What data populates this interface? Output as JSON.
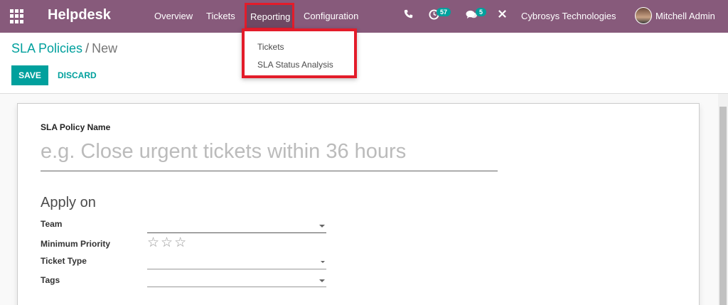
{
  "navbar": {
    "brand": "Helpdesk",
    "menu": {
      "overview": "Overview",
      "tickets": "Tickets",
      "reporting": "Reporting",
      "configuration": "Configuration"
    },
    "activity_badge": "57",
    "messages_badge": "5",
    "company": "Cybrosys Technologies",
    "user": "Mitchell Admin"
  },
  "dropdown": {
    "items": [
      "Tickets",
      "SLA Status Analysis"
    ]
  },
  "breadcrumb": {
    "parent": "SLA Policies",
    "separator": "/",
    "current": "New"
  },
  "buttons": {
    "save": "SAVE",
    "discard": "DISCARD"
  },
  "form": {
    "name_label": "SLA Policy Name",
    "name_placeholder": "e.g. Close urgent tickets within 36 hours",
    "section_title": "Apply on",
    "fields": {
      "team": "Team",
      "min_priority": "Minimum Priority",
      "ticket_type": "Ticket Type",
      "tags": "Tags"
    },
    "priority_stars": [
      "☆",
      "☆",
      "☆"
    ]
  }
}
